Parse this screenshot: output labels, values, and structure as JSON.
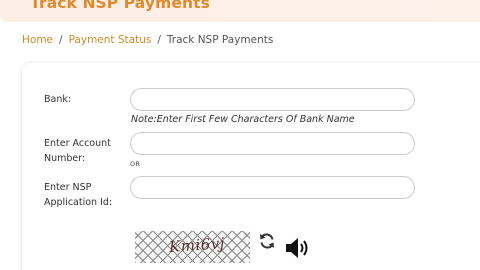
{
  "header": {
    "title": "Track NSP Payments"
  },
  "breadcrumb": {
    "home": "Home",
    "payment_status": "Payment Status",
    "current": "Track NSP Payments",
    "separator": "/"
  },
  "form": {
    "bank_label": "Bank:",
    "bank_value": "",
    "bank_note": "Note:Enter First Few Characters Of Bank Name",
    "account_label_line1": "Enter Account",
    "account_label_line2": "Number:",
    "account_value": "",
    "or_text": "OR",
    "app_id_label_line1": "Enter NSP",
    "app_id_label_line2": "Application Id:",
    "app_id_value": ""
  },
  "captcha": {
    "text": "Kmi6vj",
    "refresh_icon": "refresh-icon",
    "audio_icon": "speaker-icon"
  },
  "colors": {
    "brand_orange": "#e08a2b",
    "link": "#c98a2a",
    "banner_bg": "#fdeee6",
    "field_border": "#c9ccd1"
  }
}
